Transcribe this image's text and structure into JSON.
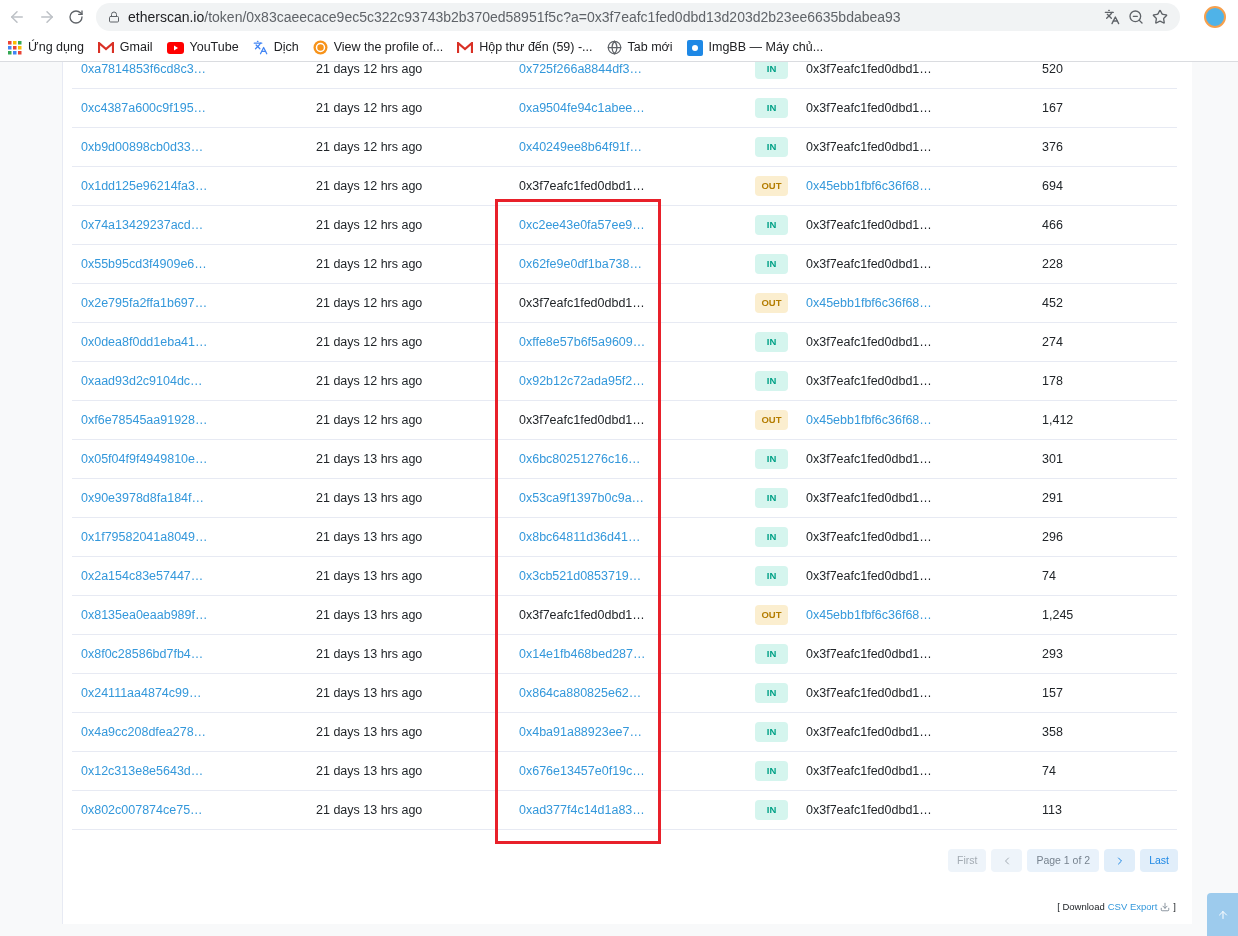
{
  "browser": {
    "url": {
      "host": "etherscan.io",
      "path": "/token/0x83caeecace9ec5c322c93743b2b370ed58951f5c?a=0x3f7eafc1fed0dbd13d203d2b23ee6635bdabea93"
    },
    "bookmarks": [
      {
        "kind": "apps",
        "label": "Ứng dụng"
      },
      {
        "kind": "mail",
        "label": "Gmail"
      },
      {
        "kind": "video",
        "label": "YouTube"
      },
      {
        "kind": "translate",
        "label": "Dịch"
      },
      {
        "kind": "coin",
        "label": "View the profile of..."
      },
      {
        "kind": "mail",
        "label": "Hộp thư đến (59) -..."
      },
      {
        "kind": "globe",
        "label": "Tab mới"
      },
      {
        "kind": "image",
        "label": "ImgBB — Máy chủ..."
      }
    ]
  },
  "table": {
    "rows": [
      {
        "hash": "0xa7814853f6cd8c3…",
        "age": "21 days 12 hrs ago",
        "from": {
          "text": "0x725f266a8844df3…",
          "link": true
        },
        "kind": "in",
        "badge": "IN",
        "to": {
          "text": "0x3f7eafc1fed0dbd1…",
          "link": false
        },
        "quantity": "520"
      },
      {
        "hash": "0xc4387a600c9f195…",
        "age": "21 days 12 hrs ago",
        "from": {
          "text": "0xa9504fe94c1abee…",
          "link": true
        },
        "kind": "in",
        "badge": "IN",
        "to": {
          "text": "0x3f7eafc1fed0dbd1…",
          "link": false
        },
        "quantity": "167"
      },
      {
        "hash": "0xb9d00898cb0d33…",
        "age": "21 days 12 hrs ago",
        "from": {
          "text": "0x40249ee8b64f91f…",
          "link": true
        },
        "kind": "in",
        "badge": "IN",
        "to": {
          "text": "0x3f7eafc1fed0dbd1…",
          "link": false
        },
        "quantity": "376"
      },
      {
        "hash": "0x1dd125e96214fa3…",
        "age": "21 days 12 hrs ago",
        "from": {
          "text": "0x3f7eafc1fed0dbd1…",
          "link": false
        },
        "kind": "out",
        "badge": "OUT",
        "to": {
          "text": "0x45ebb1fbf6c36f68…",
          "link": true
        },
        "quantity": "694"
      },
      {
        "hash": "0x74a13429237acd…",
        "age": "21 days 12 hrs ago",
        "from": {
          "text": "0xc2ee43e0fa57ee9…",
          "link": true
        },
        "kind": "in",
        "badge": "IN",
        "to": {
          "text": "0x3f7eafc1fed0dbd1…",
          "link": false
        },
        "quantity": "466"
      },
      {
        "hash": "0x55b95cd3f4909e6…",
        "age": "21 days 12 hrs ago",
        "from": {
          "text": "0x62fe9e0df1ba738…",
          "link": true
        },
        "kind": "in",
        "badge": "IN",
        "to": {
          "text": "0x3f7eafc1fed0dbd1…",
          "link": false
        },
        "quantity": "228"
      },
      {
        "hash": "0x2e795fa2ffa1b697…",
        "age": "21 days 12 hrs ago",
        "from": {
          "text": "0x3f7eafc1fed0dbd1…",
          "link": false
        },
        "kind": "out",
        "badge": "OUT",
        "to": {
          "text": "0x45ebb1fbf6c36f68…",
          "link": true
        },
        "quantity": "452"
      },
      {
        "hash": "0x0dea8f0dd1eba41…",
        "age": "21 days 12 hrs ago",
        "from": {
          "text": "0xffe8e57b6f5a9609…",
          "link": true
        },
        "kind": "in",
        "badge": "IN",
        "to": {
          "text": "0x3f7eafc1fed0dbd1…",
          "link": false
        },
        "quantity": "274"
      },
      {
        "hash": "0xaad93d2c9104dc…",
        "age": "21 days 12 hrs ago",
        "from": {
          "text": "0x92b12c72ada95f2…",
          "link": true
        },
        "kind": "in",
        "badge": "IN",
        "to": {
          "text": "0x3f7eafc1fed0dbd1…",
          "link": false
        },
        "quantity": "178"
      },
      {
        "hash": "0xf6e78545aa91928…",
        "age": "21 days 12 hrs ago",
        "from": {
          "text": "0x3f7eafc1fed0dbd1…",
          "link": false
        },
        "kind": "out",
        "badge": "OUT",
        "to": {
          "text": "0x45ebb1fbf6c36f68…",
          "link": true
        },
        "quantity": "1,412"
      },
      {
        "hash": "0x05f04f9f4949810e…",
        "age": "21 days 13 hrs ago",
        "from": {
          "text": "0x6bc80251276c16…",
          "link": true
        },
        "kind": "in",
        "badge": "IN",
        "to": {
          "text": "0x3f7eafc1fed0dbd1…",
          "link": false
        },
        "quantity": "301"
      },
      {
        "hash": "0x90e3978d8fa184f…",
        "age": "21 days 13 hrs ago",
        "from": {
          "text": "0x53ca9f1397b0c9a…",
          "link": true
        },
        "kind": "in",
        "badge": "IN",
        "to": {
          "text": "0x3f7eafc1fed0dbd1…",
          "link": false
        },
        "quantity": "291"
      },
      {
        "hash": "0x1f79582041a8049…",
        "age": "21 days 13 hrs ago",
        "from": {
          "text": "0x8bc64811d36d41…",
          "link": true
        },
        "kind": "in",
        "badge": "IN",
        "to": {
          "text": "0x3f7eafc1fed0dbd1…",
          "link": false
        },
        "quantity": "296"
      },
      {
        "hash": "0x2a154c83e57447…",
        "age": "21 days 13 hrs ago",
        "from": {
          "text": "0x3cb521d0853719…",
          "link": true
        },
        "kind": "in",
        "badge": "IN",
        "to": {
          "text": "0x3f7eafc1fed0dbd1…",
          "link": false
        },
        "quantity": "74"
      },
      {
        "hash": "0x8135ea0eaab989f…",
        "age": "21 days 13 hrs ago",
        "from": {
          "text": "0x3f7eafc1fed0dbd1…",
          "link": false
        },
        "kind": "out",
        "badge": "OUT",
        "to": {
          "text": "0x45ebb1fbf6c36f68…",
          "link": true
        },
        "quantity": "1,245"
      },
      {
        "hash": "0x8f0c28586bd7fb4…",
        "age": "21 days 13 hrs ago",
        "from": {
          "text": "0x14e1fb468bed287…",
          "link": true
        },
        "kind": "in",
        "badge": "IN",
        "to": {
          "text": "0x3f7eafc1fed0dbd1…",
          "link": false
        },
        "quantity": "293"
      },
      {
        "hash": "0x24111aa4874c99…",
        "age": "21 days 13 hrs ago",
        "from": {
          "text": "0x864ca880825e62…",
          "link": true
        },
        "kind": "in",
        "badge": "IN",
        "to": {
          "text": "0x3f7eafc1fed0dbd1…",
          "link": false
        },
        "quantity": "157"
      },
      {
        "hash": "0x4a9cc208dfea278…",
        "age": "21 days 13 hrs ago",
        "from": {
          "text": "0x4ba91a88923ee7…",
          "link": true
        },
        "kind": "in",
        "badge": "IN",
        "to": {
          "text": "0x3f7eafc1fed0dbd1…",
          "link": false
        },
        "quantity": "358"
      },
      {
        "hash": "0x12c313e8e5643d…",
        "age": "21 days 13 hrs ago",
        "from": {
          "text": "0x676e13457e0f19c…",
          "link": true
        },
        "kind": "in",
        "badge": "IN",
        "to": {
          "text": "0x3f7eafc1fed0dbd1…",
          "link": false
        },
        "quantity": "74"
      },
      {
        "hash": "0x802c007874ce75…",
        "age": "21 days 13 hrs ago",
        "from": {
          "text": "0xad377f4c14d1a83…",
          "link": true
        },
        "kind": "in",
        "badge": "IN",
        "to": {
          "text": "0x3f7eafc1fed0dbd1…",
          "link": false
        },
        "quantity": "113"
      }
    ]
  },
  "pagination": [
    {
      "kind": "text",
      "label": "First",
      "disabled": true
    },
    {
      "kind": "prev",
      "disabled": true
    },
    {
      "kind": "info",
      "label": "Page 1 of 2"
    },
    {
      "kind": "next",
      "disabled": false
    },
    {
      "kind": "text",
      "label": "Last",
      "disabled": false
    }
  ],
  "export": {
    "prefix": "[ Download",
    "link": "CSV Export",
    "suffix": "]"
  }
}
